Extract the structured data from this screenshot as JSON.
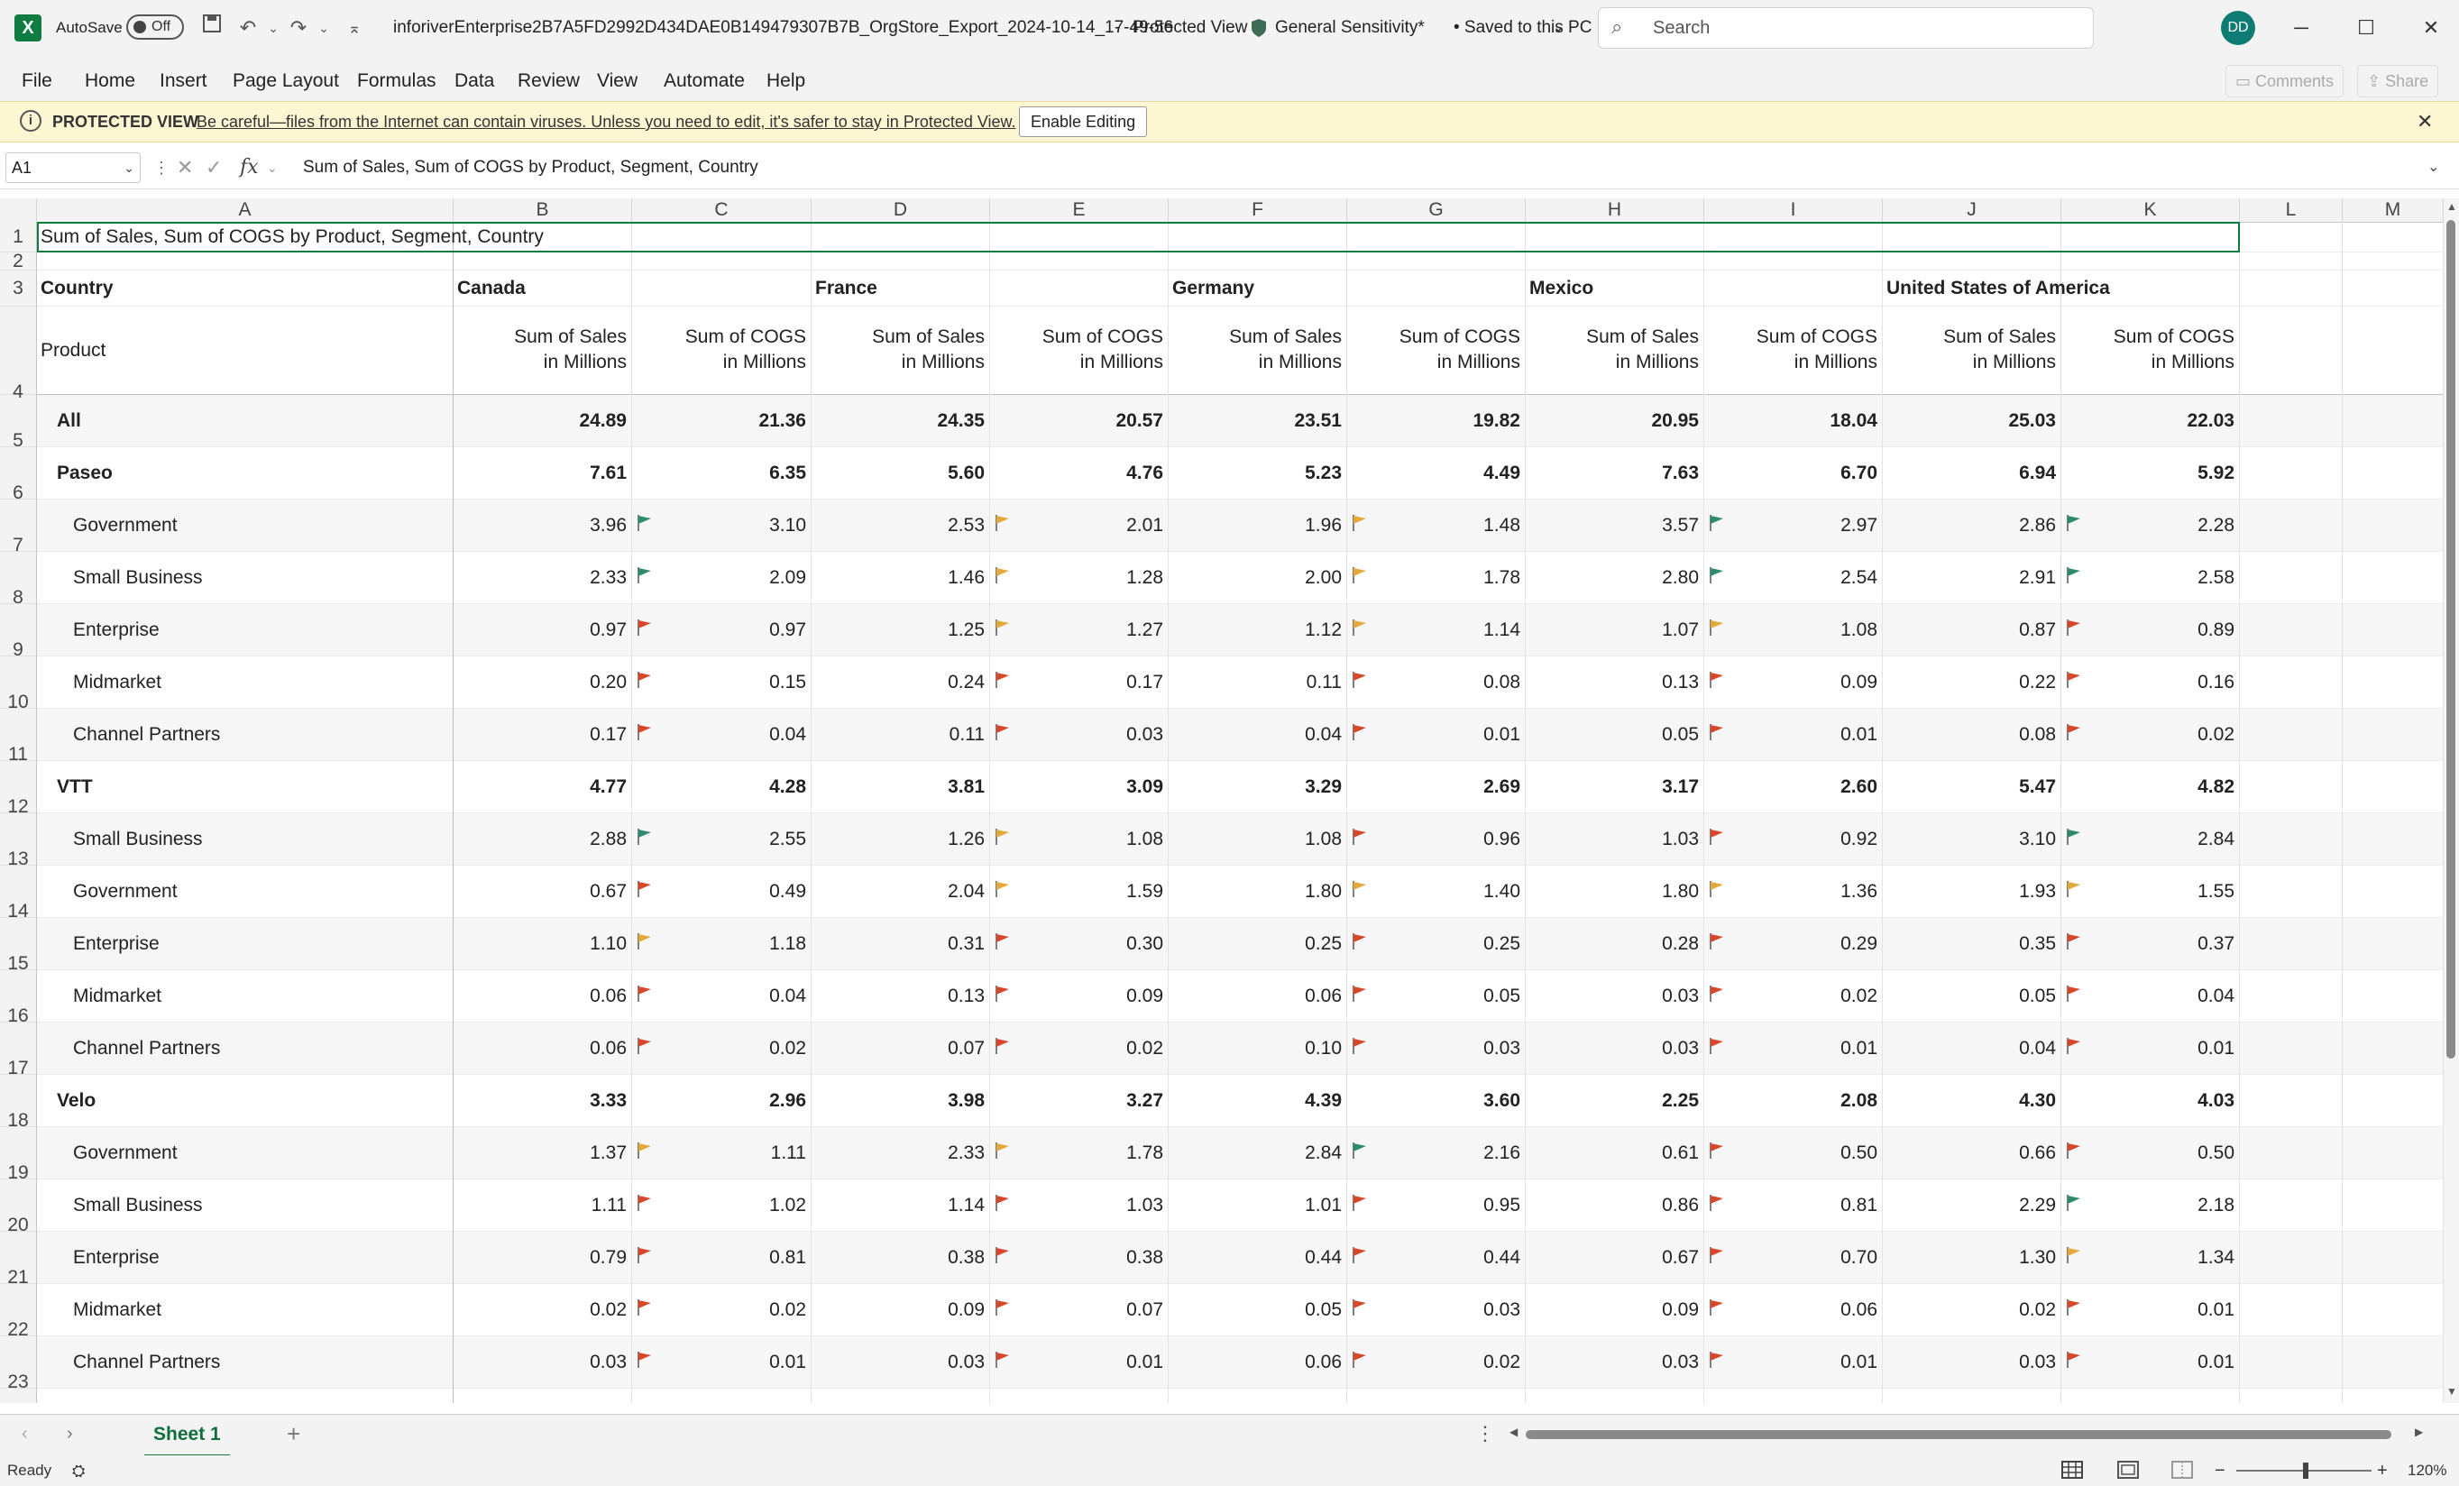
{
  "titlebar": {
    "autosave_label": "AutoSave",
    "autosave_state": "Off",
    "filename": "inforiverEnterprise2B7A5FD2992D434DAE0B149479307B7B_OrgStore_Export_2024-10-14_17-49-56",
    "separator": "-",
    "view_mode": "Protected View",
    "sensitivity": "General Sensitivity*",
    "saved_status": "• Saved to this PC",
    "search_placeholder": "Search",
    "user_initials": "DD"
  },
  "menu": {
    "items": [
      "File",
      "Home",
      "Insert",
      "Page Layout",
      "Formulas",
      "Data",
      "Review",
      "View",
      "Automate",
      "Help"
    ],
    "comments": "Comments",
    "share": "Share"
  },
  "protected_view": {
    "title": "PROTECTED VIEW",
    "message": "Be careful—files from the Internet can contain viruses. Unless you need to edit, it's safer to stay in Protected View.",
    "button": "Enable Editing"
  },
  "formula_bar": {
    "name_box": "A1",
    "fx": "fx",
    "formula": "Sum of  Sales, Sum of COGS by Product, Segment, Country"
  },
  "grid": {
    "columns": [
      "A",
      "B",
      "C",
      "D",
      "E",
      "F",
      "G",
      "H",
      "I",
      "J",
      "K",
      "L",
      "M"
    ],
    "row_numbers": [
      "1",
      "2",
      "3",
      "4",
      "5",
      "6",
      "7",
      "8",
      "9",
      "10",
      "11",
      "12",
      "13",
      "14",
      "15",
      "16",
      "17",
      "18",
      "19",
      "20",
      "21",
      "22",
      "23"
    ],
    "title": "Sum of  Sales, Sum of COGS by Product, Segment, Country",
    "country_header": "Country",
    "product_header": "Product",
    "countries": [
      "Canada",
      "France",
      "Germany",
      "Mexico",
      "United States of America"
    ],
    "measure_headers": [
      [
        "Sum of  Sales",
        "in Millions"
      ],
      [
        "Sum of COGS",
        "in Millions"
      ]
    ],
    "flag_colors": {
      "g": "#2e8b6e",
      "y": "#e3a93b",
      "r": "#d9472b"
    },
    "rows": [
      {
        "label": "All",
        "level": 0,
        "bold": true,
        "values": [
          "24.89",
          "21.36",
          "24.35",
          "20.57",
          "23.51",
          "19.82",
          "20.95",
          "18.04",
          "25.03",
          "22.03"
        ],
        "flags": [
          "",
          "",
          "",
          "",
          ""
        ]
      },
      {
        "label": "Paseo",
        "level": 0,
        "bold": true,
        "values": [
          "7.61",
          "6.35",
          "5.60",
          "4.76",
          "5.23",
          "4.49",
          "7.63",
          "6.70",
          "6.94",
          "5.92"
        ],
        "flags": [
          "",
          "",
          "",
          "",
          ""
        ]
      },
      {
        "label": "Government",
        "level": 1,
        "bold": false,
        "values": [
          "3.96",
          "3.10",
          "2.53",
          "2.01",
          "1.96",
          "1.48",
          "3.57",
          "2.97",
          "2.86",
          "2.28"
        ],
        "flags": [
          "g",
          "y",
          "y",
          "g",
          "g"
        ]
      },
      {
        "label": "Small Business",
        "level": 1,
        "bold": false,
        "values": [
          "2.33",
          "2.09",
          "1.46",
          "1.28",
          "2.00",
          "1.78",
          "2.80",
          "2.54",
          "2.91",
          "2.58"
        ],
        "flags": [
          "g",
          "y",
          "y",
          "g",
          "g"
        ]
      },
      {
        "label": "Enterprise",
        "level": 1,
        "bold": false,
        "values": [
          "0.97",
          "0.97",
          "1.25",
          "1.27",
          "1.12",
          "1.14",
          "1.07",
          "1.08",
          "0.87",
          "0.89"
        ],
        "flags": [
          "r",
          "y",
          "y",
          "y",
          "r"
        ]
      },
      {
        "label": "Midmarket",
        "level": 1,
        "bold": false,
        "values": [
          "0.20",
          "0.15",
          "0.24",
          "0.17",
          "0.11",
          "0.08",
          "0.13",
          "0.09",
          "0.22",
          "0.16"
        ],
        "flags": [
          "r",
          "r",
          "r",
          "r",
          "r"
        ]
      },
      {
        "label": "Channel Partners",
        "level": 1,
        "bold": false,
        "values": [
          "0.17",
          "0.04",
          "0.11",
          "0.03",
          "0.04",
          "0.01",
          "0.05",
          "0.01",
          "0.08",
          "0.02"
        ],
        "flags": [
          "r",
          "r",
          "r",
          "r",
          "r"
        ]
      },
      {
        "label": "VTT",
        "level": 0,
        "bold": true,
        "values": [
          "4.77",
          "4.28",
          "3.81",
          "3.09",
          "3.29",
          "2.69",
          "3.17",
          "2.60",
          "5.47",
          "4.82"
        ],
        "flags": [
          "",
          "",
          "",
          "",
          ""
        ]
      },
      {
        "label": "Small Business",
        "level": 1,
        "bold": false,
        "values": [
          "2.88",
          "2.55",
          "1.26",
          "1.08",
          "1.08",
          "0.96",
          "1.03",
          "0.92",
          "3.10",
          "2.84"
        ],
        "flags": [
          "g",
          "y",
          "r",
          "r",
          "g"
        ]
      },
      {
        "label": "Government",
        "level": 1,
        "bold": false,
        "values": [
          "0.67",
          "0.49",
          "2.04",
          "1.59",
          "1.80",
          "1.40",
          "1.80",
          "1.36",
          "1.93",
          "1.55"
        ],
        "flags": [
          "r",
          "y",
          "y",
          "y",
          "y"
        ]
      },
      {
        "label": "Enterprise",
        "level": 1,
        "bold": false,
        "values": [
          "1.10",
          "1.18",
          "0.31",
          "0.30",
          "0.25",
          "0.25",
          "0.28",
          "0.29",
          "0.35",
          "0.37"
        ],
        "flags": [
          "y",
          "r",
          "r",
          "r",
          "r"
        ]
      },
      {
        "label": "Midmarket",
        "level": 1,
        "bold": false,
        "values": [
          "0.06",
          "0.04",
          "0.13",
          "0.09",
          "0.06",
          "0.05",
          "0.03",
          "0.02",
          "0.05",
          "0.04"
        ],
        "flags": [
          "r",
          "r",
          "r",
          "r",
          "r"
        ]
      },
      {
        "label": "Channel Partners",
        "level": 1,
        "bold": false,
        "values": [
          "0.06",
          "0.02",
          "0.07",
          "0.02",
          "0.10",
          "0.03",
          "0.03",
          "0.01",
          "0.04",
          "0.01"
        ],
        "flags": [
          "r",
          "r",
          "r",
          "r",
          "r"
        ]
      },
      {
        "label": "Velo",
        "level": 0,
        "bold": true,
        "values": [
          "3.33",
          "2.96",
          "3.98",
          "3.27",
          "4.39",
          "3.60",
          "2.25",
          "2.08",
          "4.30",
          "4.03"
        ],
        "flags": [
          "",
          "",
          "",
          "",
          ""
        ]
      },
      {
        "label": "Government",
        "level": 1,
        "bold": false,
        "values": [
          "1.37",
          "1.11",
          "2.33",
          "1.78",
          "2.84",
          "2.16",
          "0.61",
          "0.50",
          "0.66",
          "0.50"
        ],
        "flags": [
          "y",
          "y",
          "g",
          "r",
          "r"
        ]
      },
      {
        "label": "Small Business",
        "level": 1,
        "bold": false,
        "values": [
          "1.11",
          "1.02",
          "1.14",
          "1.03",
          "1.01",
          "0.95",
          "0.86",
          "0.81",
          "2.29",
          "2.18"
        ],
        "flags": [
          "r",
          "r",
          "r",
          "r",
          "g"
        ]
      },
      {
        "label": "Enterprise",
        "level": 1,
        "bold": false,
        "values": [
          "0.79",
          "0.81",
          "0.38",
          "0.38",
          "0.44",
          "0.44",
          "0.67",
          "0.70",
          "1.30",
          "1.34"
        ],
        "flags": [
          "r",
          "r",
          "r",
          "r",
          "y"
        ]
      },
      {
        "label": "Midmarket",
        "level": 1,
        "bold": false,
        "values": [
          "0.02",
          "0.02",
          "0.09",
          "0.07",
          "0.05",
          "0.03",
          "0.09",
          "0.06",
          "0.02",
          "0.01"
        ],
        "flags": [
          "r",
          "r",
          "r",
          "r",
          "r"
        ]
      },
      {
        "label": "Channel Partners",
        "level": 1,
        "bold": false,
        "values": [
          "0.03",
          "0.01",
          "0.03",
          "0.01",
          "0.06",
          "0.02",
          "0.03",
          "0.01",
          "0.03",
          "0.01"
        ],
        "flags": [
          "r",
          "r",
          "r",
          "r",
          "r"
        ]
      }
    ]
  },
  "sheets": {
    "active": "Sheet 1"
  },
  "status": {
    "ready": "Ready",
    "zoom": "120%"
  }
}
